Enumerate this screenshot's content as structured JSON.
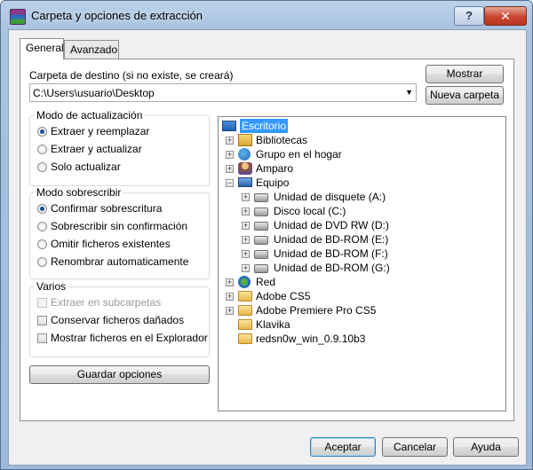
{
  "window": {
    "title": "Carpeta y opciones de extracción",
    "help_label": "?",
    "close_label": "✕"
  },
  "tabs": [
    {
      "label": "General",
      "active": true
    },
    {
      "label": "Avanzado",
      "active": false
    }
  ],
  "destination": {
    "label": "Carpeta de destino (si no existe, se creará)",
    "value": "C:\\Users\\usuario\\Desktop",
    "show_button": "Mostrar",
    "new_folder_button": "Nueva carpeta"
  },
  "update_mode": {
    "title": "Modo de actualización",
    "options": [
      "Extraer y reemplazar",
      "Extraer y actualizar",
      "Solo actualizar"
    ],
    "selected": 0
  },
  "overwrite_mode": {
    "title": "Modo sobrescribir",
    "options": [
      "Confirmar sobrescritura",
      "Sobrescribir sin confirmación",
      "Omitir ficheros existentes",
      "Renombrar automaticamente"
    ],
    "selected": 0
  },
  "misc": {
    "title": "Varios",
    "checks": [
      {
        "label": "Extraer en subcarpetas",
        "checked": false,
        "disabled": true
      },
      {
        "label": "Conservar ficheros dañados",
        "checked": false,
        "disabled": false
      },
      {
        "label": "Mostrar ficheros en el Explorador",
        "checked": false,
        "disabled": false
      }
    ]
  },
  "save_options_button": "Guardar opciones",
  "tree": [
    {
      "label": "Escritorio",
      "icon": "desktop-icon",
      "selected": true
    },
    {
      "label": "Bibliotecas",
      "icon": "library-icon"
    },
    {
      "label": "Grupo en el hogar",
      "icon": "homegroup-icon"
    },
    {
      "label": "Amparo",
      "icon": "user-folder-icon"
    },
    {
      "label": "Equipo",
      "icon": "computer-icon"
    },
    {
      "label": "Unidad de disquete (A:)",
      "icon": "floppy-drive-icon"
    },
    {
      "label": "Disco local (C:)",
      "icon": "local-disk-icon"
    },
    {
      "label": "Unidad de DVD RW (D:)",
      "icon": "dvd-drive-icon"
    },
    {
      "label": "Unidad de BD-ROM (E:)",
      "icon": "bd-drive-icon"
    },
    {
      "label": "Unidad de BD-ROM (F:)",
      "icon": "bd-drive-icon"
    },
    {
      "label": "Unidad de BD-ROM (G:)",
      "icon": "bd-drive-icon"
    },
    {
      "label": "Red",
      "icon": "network-icon"
    },
    {
      "label": "Adobe CS5",
      "icon": "folder-icon"
    },
    {
      "label": "Adobe Premiere Pro CS5",
      "icon": "folder-icon"
    },
    {
      "label": "Klavika",
      "icon": "folder-icon"
    },
    {
      "label": "redsn0w_win_0.9.10b3",
      "icon": "folder-icon"
    }
  ],
  "footer": {
    "ok": "Aceptar",
    "cancel": "Cancelar",
    "help": "Ayuda"
  }
}
